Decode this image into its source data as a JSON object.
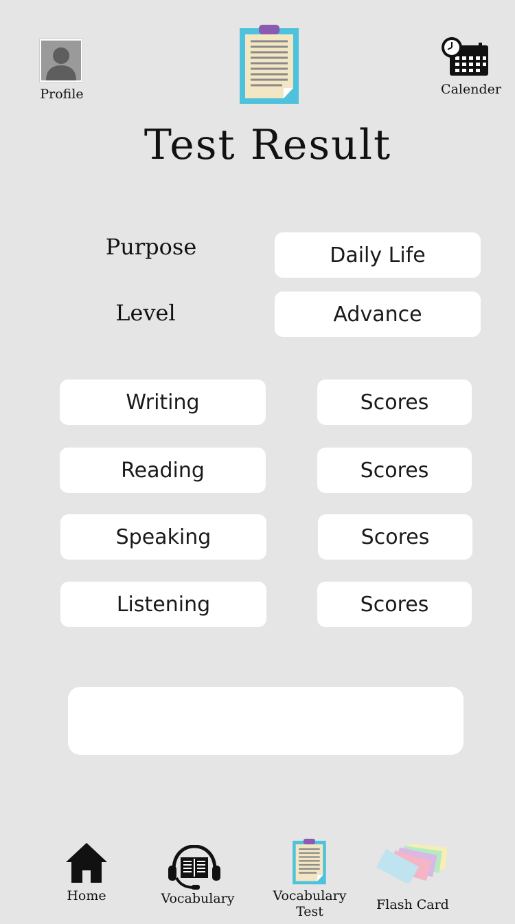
{
  "header": {
    "profile_label": "Profile",
    "calendar_label": "Calender",
    "title": "Test Result"
  },
  "settings": {
    "purpose_label": "Purpose",
    "purpose_value": "Daily Life",
    "level_label": "Level",
    "level_value": "Advance"
  },
  "skills": [
    {
      "name": "Writing",
      "score": "Scores"
    },
    {
      "name": "Reading",
      "score": "Scores"
    },
    {
      "name": "Speaking",
      "score": "Scores"
    },
    {
      "name": "Listening",
      "score": "Scores"
    }
  ],
  "nav": {
    "home": "Home",
    "vocabulary": "Vocabulary",
    "vocab_test_line1": "Vocabulary",
    "vocab_test_line2": "Test",
    "flash_card": "Flash Card"
  },
  "colors": {
    "background": "#e5e5e5",
    "clipboard_border": "#4ec2dc",
    "clipboard_paper": "#f3e6c4",
    "clipboard_clip": "#8a5bb0"
  }
}
